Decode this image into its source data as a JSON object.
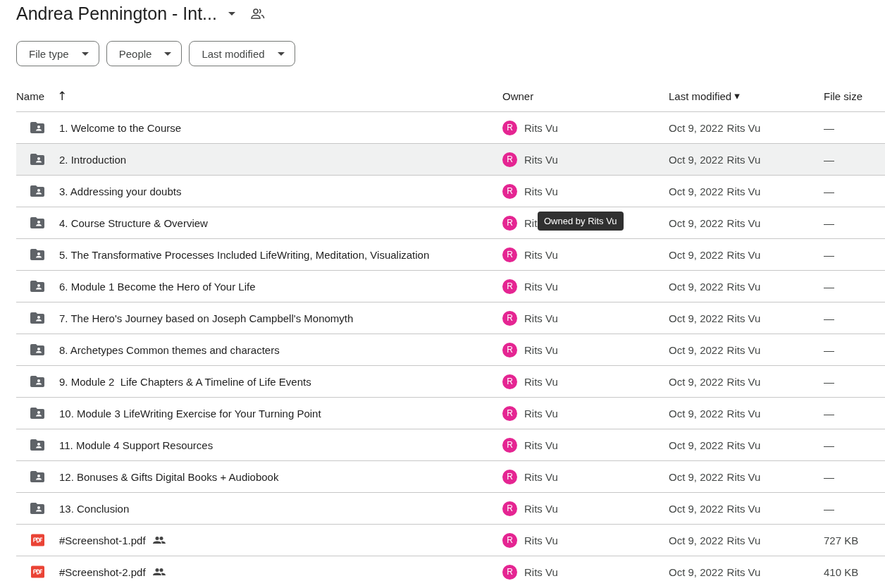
{
  "header": {
    "title": "Andrea Pennington - Int...",
    "filters": [
      "File type",
      "People",
      "Last modified"
    ]
  },
  "table": {
    "columns": [
      {
        "label": "Name",
        "sort_icon": "↑"
      },
      {
        "label": "Owner"
      },
      {
        "label": "Last modified",
        "sort_icon": "▾"
      },
      {
        "label": "File size"
      }
    ],
    "rows": [
      {
        "kind": "folder",
        "name": "1. Welcome to the Course",
        "shared": false,
        "selected": false,
        "owner_initial": "R",
        "owner": "Rits Vu",
        "modified": "Oct 9, 2022",
        "modified_by": "Rits Vu",
        "size": "—"
      },
      {
        "kind": "folder",
        "name": "2. Introduction",
        "shared": false,
        "selected": true,
        "owner_initial": "R",
        "owner": "Rits Vu",
        "modified": "Oct 9, 2022",
        "modified_by": "Rits Vu",
        "size": "—"
      },
      {
        "kind": "folder",
        "name": "3. Addressing your doubts",
        "shared": false,
        "selected": false,
        "owner_initial": "R",
        "owner": "Rits Vu",
        "modified": "Oct 9, 2022",
        "modified_by": "Rits Vu",
        "size": "—"
      },
      {
        "kind": "folder",
        "name": "4. Course Structure & Overview",
        "shared": false,
        "selected": false,
        "owner_initial": "R",
        "owner": "Rit",
        "tooltip": "Owned by Rits Vu",
        "modified": "Oct 9, 2022",
        "modified_by": "Rits Vu",
        "size": "—"
      },
      {
        "kind": "folder",
        "name": "5. The Transformative Processes Included LifeWriting, Meditation, Visualization",
        "shared": false,
        "selected": false,
        "owner_initial": "R",
        "owner": "Rits Vu",
        "modified": "Oct 9, 2022",
        "modified_by": "Rits Vu",
        "size": "—"
      },
      {
        "kind": "folder",
        "name": "6. Module 1 Become the Hero of Your Life",
        "shared": false,
        "selected": false,
        "owner_initial": "R",
        "owner": "Rits Vu",
        "modified": "Oct 9, 2022",
        "modified_by": "Rits Vu",
        "size": "—"
      },
      {
        "kind": "folder",
        "name": "7. The Hero's Journey based on Joseph Campbell's Monomyth",
        "shared": false,
        "selected": false,
        "owner_initial": "R",
        "owner": "Rits Vu",
        "modified": "Oct 9, 2022",
        "modified_by": "Rits Vu",
        "size": "—"
      },
      {
        "kind": "folder",
        "name": "8. Archetypes Common themes and characters",
        "shared": false,
        "selected": false,
        "owner_initial": "R",
        "owner": "Rits Vu",
        "modified": "Oct 9, 2022",
        "modified_by": "Rits Vu",
        "size": "—"
      },
      {
        "kind": "folder",
        "name": "9. Module 2  Life Chapters & A Timeline of Life Events",
        "shared": false,
        "selected": false,
        "owner_initial": "R",
        "owner": "Rits Vu",
        "modified": "Oct 9, 2022",
        "modified_by": "Rits Vu",
        "size": "—"
      },
      {
        "kind": "folder",
        "name": "10. Module 3 LifeWriting Exercise for Your Turning Point",
        "shared": false,
        "selected": false,
        "owner_initial": "R",
        "owner": "Rits Vu",
        "modified": "Oct 9, 2022",
        "modified_by": "Rits Vu",
        "size": "—"
      },
      {
        "kind": "folder",
        "name": "11. Module 4 Support Resources",
        "shared": false,
        "selected": false,
        "owner_initial": "R",
        "owner": "Rits Vu",
        "modified": "Oct 9, 2022",
        "modified_by": "Rits Vu",
        "size": "—"
      },
      {
        "kind": "folder",
        "name": "12. Bonuses & Gifts Digital Books + Audiobook",
        "shared": false,
        "selected": false,
        "owner_initial": "R",
        "owner": "Rits Vu",
        "modified": "Oct 9, 2022",
        "modified_by": "Rits Vu",
        "size": "—"
      },
      {
        "kind": "folder",
        "name": "13. Conclusion",
        "shared": false,
        "selected": false,
        "owner_initial": "R",
        "owner": "Rits Vu",
        "modified": "Oct 9, 2022",
        "modified_by": "Rits Vu",
        "size": "—"
      },
      {
        "kind": "pdf",
        "name": "#Screenshot-1.pdf",
        "shared": true,
        "selected": false,
        "owner_initial": "R",
        "owner": "Rits Vu",
        "modified": "Oct 9, 2022",
        "modified_by": "Rits Vu",
        "size": "727 KB"
      },
      {
        "kind": "pdf",
        "name": "#Screenshot-2.pdf",
        "shared": true,
        "selected": false,
        "owner_initial": "R",
        "owner": "Rits Vu",
        "modified": "Oct 9, 2022",
        "modified_by": "Rits Vu",
        "size": "410 KB"
      }
    ]
  }
}
